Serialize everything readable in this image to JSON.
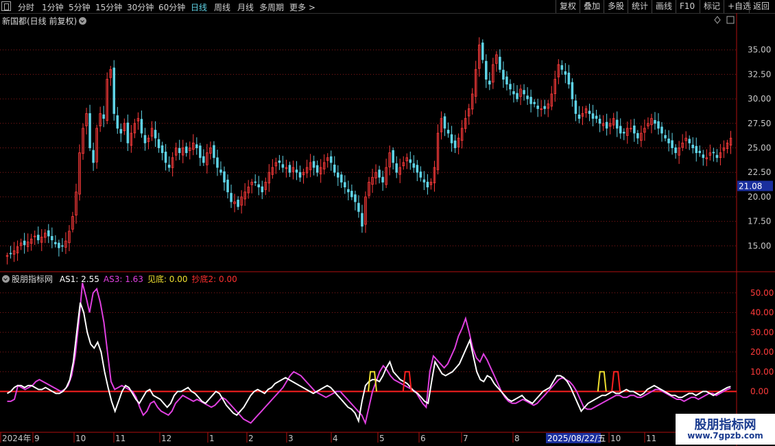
{
  "toolbar": {
    "periods": [
      "分时",
      "1分钟",
      "5分钟",
      "15分钟",
      "30分钟",
      "60分钟",
      "日线",
      "周线",
      "月线",
      "多周期",
      "更多"
    ],
    "active": "日线",
    "right_buttons": [
      "复权",
      "叠加",
      "多股",
      "统计",
      "画线",
      "F10",
      "标记",
      "+自选",
      "返回"
    ]
  },
  "price_panel": {
    "title": "新国都(日线 前复权)",
    "y_ticks": [
      "35.00",
      "32.50",
      "30.00",
      "27.50",
      "25.00",
      "22.50",
      "20.00",
      "17.50",
      "15.00"
    ],
    "current_price_label": "21.08"
  },
  "indicator_panel": {
    "name": "股朋指标网",
    "legends": [
      {
        "label": "AS1: 2.55",
        "color": "#ffffff"
      },
      {
        "label": "AS3: 1.63",
        "color": "#e040e0"
      },
      {
        "label": "见底: 0.00",
        "color": "#f0e030"
      },
      {
        "label": "抄底2: 0.00",
        "color": "#ff3030"
      }
    ],
    "y_ticks": [
      "50.00",
      "40.00",
      "30.00",
      "20.00",
      "10.00",
      "0.00"
    ]
  },
  "time_axis": {
    "labels": [
      "2024年",
      "9",
      "10",
      "11",
      "12",
      "1",
      "2",
      "3",
      "4",
      "5",
      "6",
      "7",
      "8",
      "10",
      "11"
    ],
    "cursor_date": "2025/08/22/五"
  },
  "watermark": {
    "title": "股朋指标网",
    "url": "www.7gpzb.com"
  },
  "colors": {
    "up": "#ff3b3b",
    "down": "#5fd3e6",
    "as1": "#ffffff",
    "as3": "#e040e0",
    "signal_yellow": "#f0e030",
    "signal_red": "#ff2020",
    "grid": "#8b1a1a",
    "axis": "#b01010"
  },
  "chart_data": {
    "type": "candlestick",
    "price_ylim": [
      12.5,
      37.5
    ],
    "closes": [
      14.0,
      14.2,
      14.5,
      14.9,
      15.3,
      15.1,
      15.4,
      15.7,
      16.0,
      15.6,
      15.9,
      16.3,
      16.0,
      15.6,
      15.2,
      14.8,
      15.0,
      15.5,
      16.5,
      18.0,
      20.5,
      24.5,
      27.0,
      28.5,
      25.0,
      23.5,
      27.0,
      28.5,
      28.0,
      32.0,
      33.0,
      28.5,
      27.0,
      26.5,
      27.5,
      25.5,
      26.5,
      27.5,
      28.0,
      26.5,
      25.5,
      26.0,
      27.0,
      26.0,
      25.0,
      24.5,
      23.5,
      23.0,
      24.0,
      25.0,
      24.5,
      25.0,
      24.5,
      25.0,
      25.5,
      25.0,
      24.0,
      23.5,
      24.5,
      25.0,
      24.0,
      23.0,
      22.5,
      21.5,
      20.5,
      19.5,
      19.5,
      19.0,
      20.0,
      20.5,
      21.0,
      21.5,
      21.5,
      21.0,
      20.5,
      21.5,
      22.5,
      23.0,
      23.5,
      23.5,
      23.0,
      23.0,
      22.5,
      23.0,
      22.5,
      22.0,
      22.5,
      23.0,
      23.5,
      23.0,
      22.5,
      23.0,
      23.5,
      24.0,
      23.5,
      22.5,
      22.0,
      21.5,
      21.0,
      20.5,
      20.0,
      19.5,
      18.5,
      17.0,
      20.0,
      21.5,
      22.0,
      22.5,
      22.0,
      21.5,
      23.0,
      24.5,
      23.5,
      22.5,
      23.0,
      23.5,
      24.0,
      23.5,
      23.0,
      22.5,
      22.0,
      21.5,
      21.0,
      21.5,
      23.0,
      26.5,
      28.0,
      27.0,
      26.5,
      25.5,
      25.0,
      26.0,
      27.0,
      28.0,
      29.0,
      30.5,
      33.0,
      35.5,
      34.0,
      32.0,
      31.5,
      33.5,
      34.5,
      33.0,
      32.0,
      31.5,
      31.0,
      30.5,
      30.0,
      31.0,
      30.5,
      30.0,
      29.5,
      29.5,
      29.0,
      29.0,
      29.0,
      29.5,
      30.5,
      32.0,
      33.5,
      33.0,
      32.5,
      31.5,
      30.0,
      28.5,
      28.0,
      28.5,
      29.0,
      28.5,
      28.0,
      28.0,
      27.5,
      27.5,
      27.0,
      27.5,
      28.0,
      27.0,
      26.5,
      26.5,
      27.0,
      27.0,
      26.5,
      26.0,
      26.5,
      27.0,
      27.5,
      28.0,
      27.5,
      27.0,
      26.5,
      26.0,
      25.5,
      25.0,
      24.5,
      25.0,
      25.5,
      26.0,
      25.5,
      25.0,
      24.5,
      24.5,
      24.0,
      24.0,
      24.5,
      24.5,
      24.0,
      24.5,
      25.0,
      25.5,
      26.0
    ],
    "as1": [
      -1,
      0,
      2,
      3,
      3,
      2,
      3,
      3,
      2,
      1,
      1,
      2,
      1,
      0,
      -1,
      -1,
      0,
      2,
      6,
      15,
      30,
      45,
      40,
      30,
      24,
      22,
      25,
      20,
      10,
      2,
      -5,
      -10,
      -5,
      0,
      3,
      2,
      -1,
      -4,
      -6,
      -3,
      0,
      1,
      -2,
      -3,
      -4,
      -6,
      -8,
      -6,
      -2,
      0,
      0,
      1,
      2,
      0,
      -1,
      -3,
      -5,
      -6,
      -4,
      -2,
      0,
      -1,
      -4,
      -7,
      -9,
      -11,
      -12,
      -10,
      -8,
      -5,
      -2,
      0,
      1,
      0,
      -1,
      1,
      2,
      4,
      5,
      6,
      7,
      6,
      5,
      4,
      3,
      2,
      1,
      0,
      -1,
      0,
      1,
      2,
      3,
      2,
      0,
      -2,
      -4,
      -6,
      -8,
      -9,
      -11,
      -15,
      -5,
      3,
      5,
      6,
      6,
      5,
      8,
      12,
      15,
      10,
      8,
      6,
      5,
      4,
      2,
      0,
      -1,
      -3,
      -5,
      -6,
      5,
      15,
      12,
      9,
      8,
      9,
      10,
      12,
      14,
      18,
      22,
      26,
      18,
      10,
      6,
      5,
      8,
      7,
      4,
      2,
      0,
      -2,
      -4,
      -5,
      -4,
      -3,
      -2,
      -4,
      -5,
      -6,
      -4,
      -2,
      0,
      1,
      2,
      5,
      8,
      8,
      7,
      5,
      2,
      -2,
      -6,
      -10,
      -8,
      -6,
      -5,
      -4,
      -3,
      -2,
      -2,
      -1,
      0,
      -1,
      -1,
      0,
      1,
      0,
      0,
      -1,
      -2,
      -1,
      1,
      2,
      3,
      2,
      1,
      0,
      -1,
      -2,
      -2,
      -3,
      -3,
      -2,
      -1,
      -1,
      -2,
      -1,
      0,
      0,
      -1,
      -2,
      -1,
      0,
      1,
      2,
      2.5
    ],
    "as3": [
      -5,
      -5,
      -4,
      3,
      2,
      1,
      2,
      3,
      5,
      6,
      5,
      4,
      3,
      2,
      1,
      0,
      1,
      3,
      8,
      18,
      35,
      55,
      48,
      40,
      50,
      52,
      45,
      35,
      20,
      5,
      1,
      2,
      3,
      2,
      1,
      0,
      -3,
      -8,
      -12,
      -10,
      -6,
      -5,
      -8,
      -10,
      -11,
      -12,
      -10,
      -6,
      -4,
      -2,
      -3,
      -4,
      -5,
      -4,
      -5,
      -6,
      -7,
      -8,
      -7,
      -5,
      -3,
      -4,
      -6,
      -8,
      -10,
      -12,
      -14,
      -15,
      -16,
      -14,
      -12,
      -10,
      -8,
      -6,
      -4,
      -2,
      0,
      2,
      5,
      8,
      10,
      9,
      8,
      6,
      4,
      2,
      0,
      -1,
      -2,
      -3,
      -2,
      -1,
      0,
      0,
      -2,
      -4,
      -6,
      -8,
      -10,
      -12,
      -16,
      -8,
      0,
      5,
      10,
      13,
      11,
      8,
      6,
      5,
      4,
      3,
      2,
      1,
      0,
      -3,
      -6,
      -8,
      10,
      18,
      16,
      14,
      12,
      14,
      18,
      22,
      28,
      32,
      37,
      30,
      22,
      17,
      15,
      19,
      16,
      12,
      8,
      4,
      0,
      -3,
      -5,
      -6,
      -6,
      -5,
      -4,
      -5,
      -6,
      -7,
      -6,
      -4,
      -2,
      0,
      2,
      4,
      6,
      7,
      6,
      5,
      3,
      0,
      -4,
      -8,
      -9,
      -9,
      -8,
      -7,
      -6,
      -5,
      -4,
      -3,
      -2,
      -2,
      -3,
      -3,
      -2,
      -2,
      -3,
      -3,
      -2,
      -1,
      0,
      1,
      1,
      0,
      -1,
      -2,
      -3,
      -4,
      -4,
      -5,
      -4,
      -3,
      -3,
      -4,
      -3,
      -2,
      -1,
      -1,
      -2,
      -1,
      0,
      1,
      1.63
    ],
    "indicator_ylim": [
      -20,
      60
    ],
    "yellow_signals": [
      105,
      171
    ],
    "red_signals": [
      115,
      175
    ]
  }
}
